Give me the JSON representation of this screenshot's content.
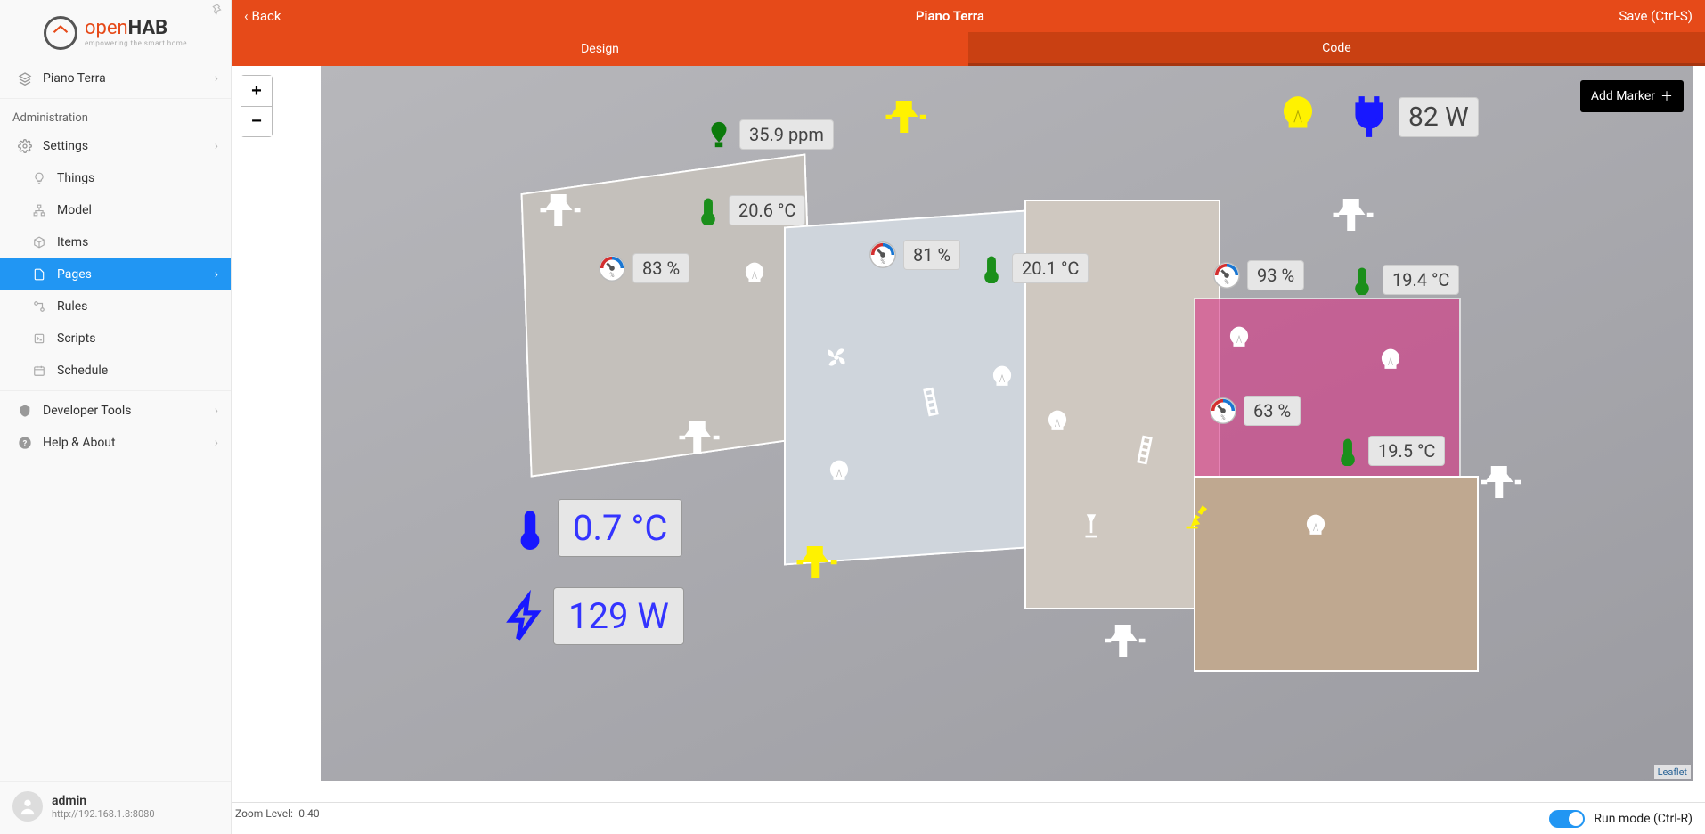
{
  "app": {
    "name_prefix": "open",
    "name_bold": "HAB",
    "tagline": "empowering the smart home"
  },
  "topbar": {
    "back": "Back",
    "title": "Piano Terra",
    "save": "Save (Ctrl-S)"
  },
  "tabs": {
    "design": "Design",
    "code": "Code",
    "active": "design"
  },
  "sidebar": {
    "breadcrumb": "Piano Terra",
    "admin_heading": "Administration",
    "settings": "Settings",
    "nav": [
      {
        "label": "Things",
        "icon": "lightbulb"
      },
      {
        "label": "Model",
        "icon": "sitemap"
      },
      {
        "label": "Items",
        "icon": "cube"
      },
      {
        "label": "Pages",
        "icon": "document",
        "active": true
      },
      {
        "label": "Rules",
        "icon": "flow"
      },
      {
        "label": "Scripts",
        "icon": "script"
      },
      {
        "label": "Schedule",
        "icon": "calendar"
      }
    ],
    "developer_tools": "Developer Tools",
    "help": "Help & About"
  },
  "user": {
    "name": "admin",
    "host": "http://192.168.1.8:8080"
  },
  "canvas": {
    "zoom_level_label": "Zoom Level: -0.40",
    "leaflet": "Leaflet",
    "add_marker": "Add Marker",
    "run_mode": "Run mode (Ctrl-R)"
  },
  "markers": {
    "co2": "35.9 ppm",
    "t_cucina": "20.6 °C",
    "h_cucina": "83 %",
    "h_living": "81 %",
    "t_living": "20.1 °C",
    "h_bagno": "93 %",
    "t_bagno": "19.4 °C",
    "h_camera": "63 %",
    "t_camera": "19.5 °C",
    "t_ext": "0.7 °C",
    "w_total": "129 W",
    "w_top": "82 W"
  }
}
